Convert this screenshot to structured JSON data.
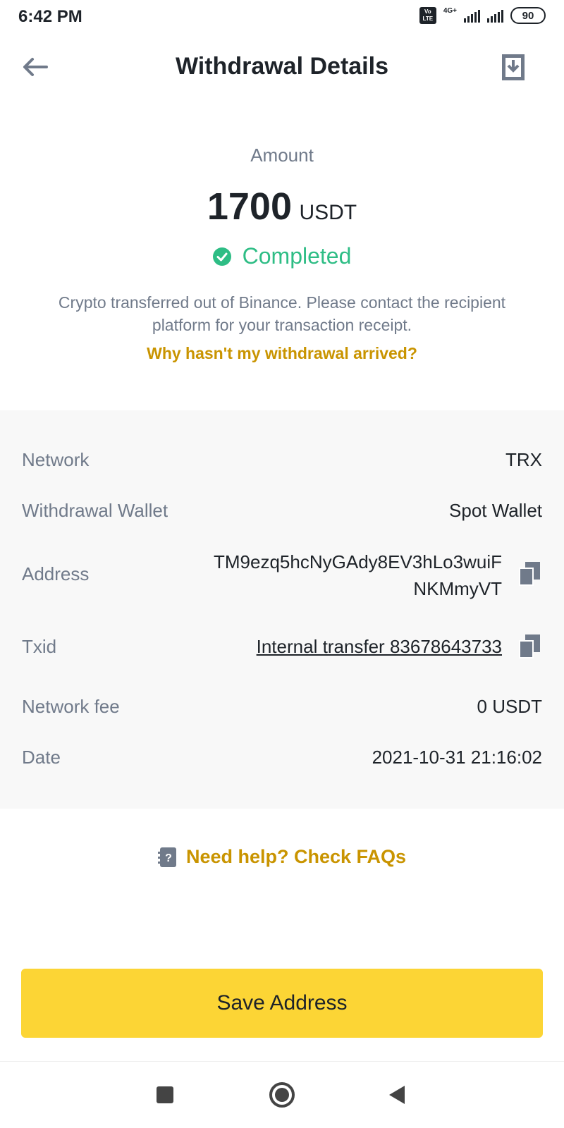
{
  "status_bar": {
    "time": "6:42 PM",
    "volte": "Vo LTE",
    "network": "4G+",
    "battery": "90"
  },
  "header": {
    "title": "Withdrawal Details",
    "back_icon": "arrow-left-icon",
    "download_icon": "download-icon"
  },
  "amount": {
    "label": "Amount",
    "value": "1700",
    "unit": "USDT",
    "status": "Completed",
    "status_color": "#2ebd85",
    "description": "Crypto transferred out of Binance. Please contact the recipient platform for your transaction receipt.",
    "help_link": "Why hasn't my withdrawal arrived?"
  },
  "details": {
    "network": {
      "label": "Network",
      "value": "TRX"
    },
    "wallet": {
      "label": "Withdrawal Wallet",
      "value": "Spot Wallet"
    },
    "address": {
      "label": "Address",
      "value": "TM9ezq5hcNyGAdy8EV3hLo3wuiFNKMmyVT"
    },
    "txid": {
      "label": "Txid",
      "value": "Internal transfer 83678643733"
    },
    "fee": {
      "label": "Network fee",
      "value": "0 USDT"
    },
    "date": {
      "label": "Date",
      "value": "2021-10-31 21:16:02"
    }
  },
  "help": {
    "text": "Need help? Check FAQs"
  },
  "actions": {
    "save_label": "Save Address"
  },
  "colors": {
    "accent": "#fcd535",
    "link": "#c99400",
    "muted": "#707a8a",
    "text": "#1e2329"
  }
}
